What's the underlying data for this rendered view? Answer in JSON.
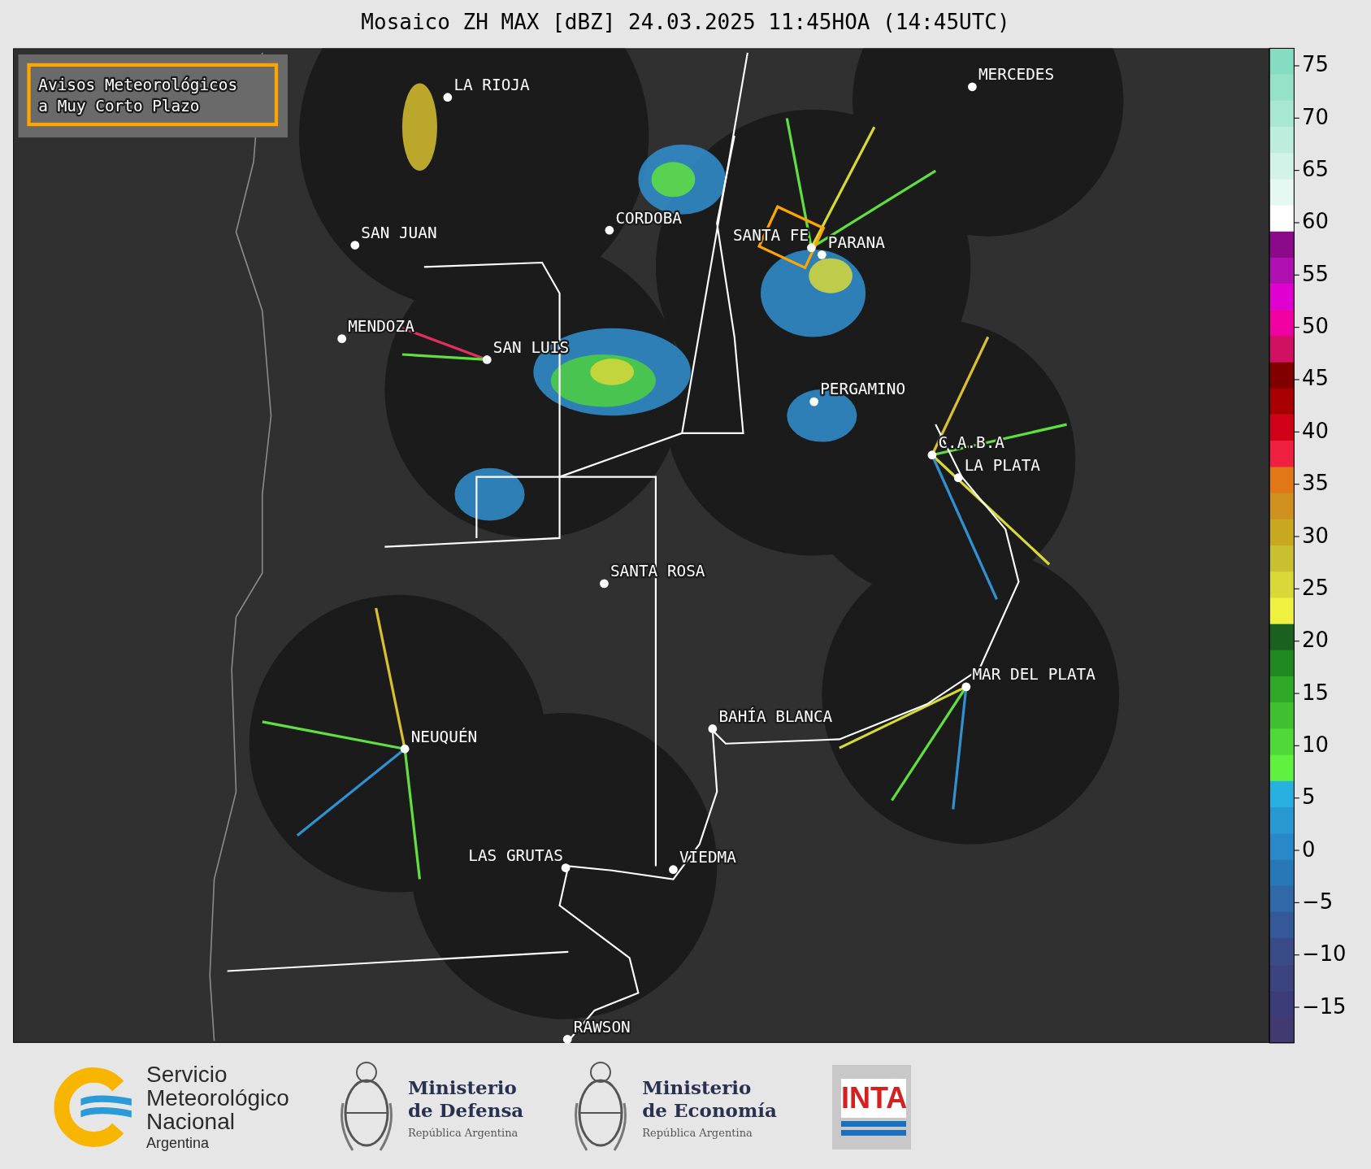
{
  "title": "Mosaico ZH MAX [dBZ] 24.03.2025 11:45HOA (14:45UTC)",
  "alert_box": {
    "lines": [
      "Avisos Meteorológicos",
      "a Muy Corto Plazo"
    ]
  },
  "cities": [
    "LA RIOJA",
    "MERCEDES",
    "CORDOBA",
    "SAN JUAN",
    "SANTA FE",
    "PARANA",
    "MENDOZA",
    "SAN LUIS",
    "PERGAMINO",
    "C.A.B.A",
    "LA PLATA",
    "SANTA ROSA",
    "MAR DEL PLATA",
    "BAHÍA BLANCA",
    "NEUQUÉN",
    "LAS GRUTAS",
    "VIEDMA",
    "RAWSON"
  ],
  "colorbar": {
    "ticks": [
      "75",
      "70",
      "65",
      "60",
      "55",
      "50",
      "45",
      "40",
      "35",
      "30",
      "25",
      "20",
      "15",
      "10",
      "5",
      "0",
      "−5",
      "−10",
      "−15"
    ]
  },
  "footer_logos": [
    {
      "kind": "smn",
      "lines": [
        "Servicio",
        "Meteorológico",
        "Nacional"
      ],
      "subtitle": "Argentina"
    },
    {
      "kind": "ministry",
      "lines": [
        "Ministerio",
        "de Defensa"
      ],
      "subtitle": "República Argentina"
    },
    {
      "kind": "ministry",
      "lines": [
        "Ministerio",
        "de Economía"
      ],
      "subtitle": "República Argentina"
    },
    {
      "kind": "inta",
      "lines": [
        "INTA"
      ]
    }
  ]
}
